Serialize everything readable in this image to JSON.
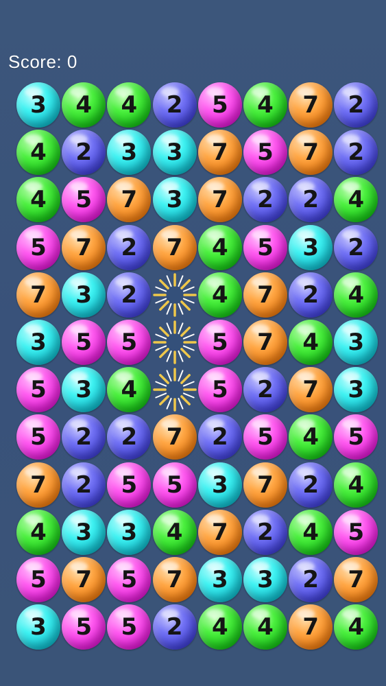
{
  "score_label": "Score: 0",
  "colors": {
    "2": "blue",
    "3": "cyan",
    "4": "green",
    "5": "magenta",
    "7": "orange"
  },
  "grid": [
    [
      3,
      4,
      4,
      2,
      5,
      4,
      7,
      2
    ],
    [
      4,
      2,
      3,
      3,
      7,
      5,
      7,
      2
    ],
    [
      4,
      5,
      7,
      3,
      7,
      2,
      2,
      4
    ],
    [
      5,
      7,
      2,
      7,
      4,
      5,
      3,
      2
    ],
    [
      7,
      3,
      2,
      null,
      4,
      7,
      2,
      4
    ],
    [
      3,
      5,
      5,
      null,
      5,
      7,
      4,
      3
    ],
    [
      5,
      3,
      4,
      null,
      5,
      2,
      7,
      3
    ],
    [
      5,
      2,
      2,
      7,
      2,
      5,
      4,
      5
    ],
    [
      7,
      2,
      5,
      5,
      3,
      7,
      2,
      4
    ],
    [
      4,
      3,
      3,
      4,
      7,
      2,
      4,
      5
    ],
    [
      5,
      7,
      5,
      7,
      3,
      3,
      2,
      7
    ],
    [
      3,
      5,
      5,
      2,
      4,
      4,
      7,
      4
    ]
  ],
  "empty_cell_icon": "sparkle-burst-icon"
}
